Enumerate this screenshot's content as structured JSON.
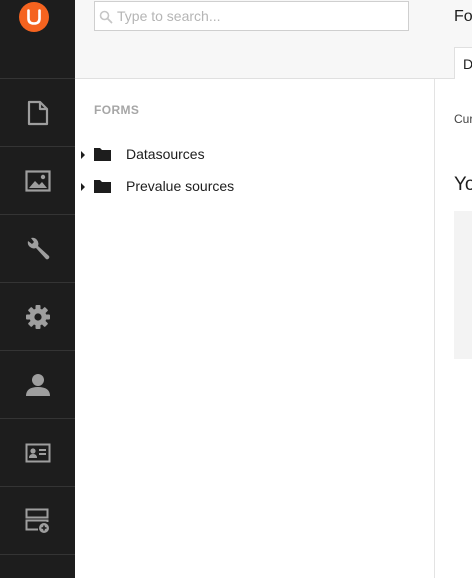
{
  "rail": {
    "logo": "umbraco-logo",
    "items": [
      {
        "icon": "document-icon",
        "name": "content"
      },
      {
        "icon": "image-icon",
        "name": "media"
      },
      {
        "icon": "wrench-icon",
        "name": "settings"
      },
      {
        "icon": "gear-icon",
        "name": "developer"
      },
      {
        "icon": "user-icon",
        "name": "users"
      },
      {
        "icon": "id-card-icon",
        "name": "members"
      },
      {
        "icon": "form-add-icon",
        "name": "forms"
      }
    ]
  },
  "search": {
    "placeholder": "Type to search..."
  },
  "tree": {
    "section_label": "FORMS",
    "nodes": [
      {
        "label": "Datasources",
        "icon": "folder-icon"
      },
      {
        "label": "Prevalue sources",
        "icon": "folder-icon"
      }
    ]
  },
  "editor": {
    "title": "Fo",
    "tab": "D",
    "small_text": "Cur",
    "heading": "Yo"
  },
  "colors": {
    "rail_bg": "#1d1d1d",
    "accent": "#f5631f",
    "icon": "#9e9e9e"
  }
}
